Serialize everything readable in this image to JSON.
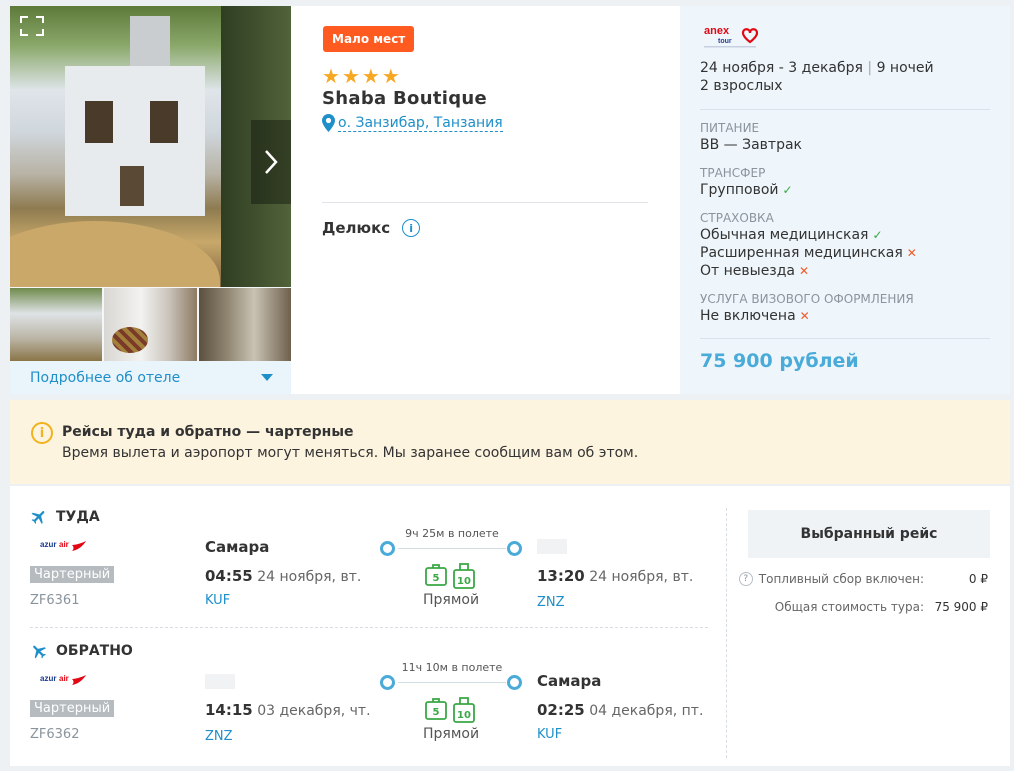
{
  "hotel": {
    "badge": "Мало мест",
    "stars": 4,
    "name": "Shaba Boutique",
    "location": "о. Занзибар, Танзания",
    "room": "Делюкс",
    "more_link": "Подробнее об отеле"
  },
  "tour": {
    "dates": "24 ноября - 3 декабря",
    "nights": "9 ночей",
    "guests": "2 взрослых",
    "meal_label": "ПИТАНИЕ",
    "meal_value": "BB — Завтрак",
    "transfer_label": "ТРАНСФЕР",
    "transfer_value": "Групповой",
    "insurance_label": "СТРАХОВКА",
    "insurance_items": [
      {
        "text": "Обычная медицинская",
        "included": true
      },
      {
        "text": "Расширенная медицинская",
        "included": false
      },
      {
        "text": "От невыезда",
        "included": false
      }
    ],
    "visa_label": "УСЛУГА ВИЗОВОГО ОФОРМЛЕНИЯ",
    "visa_value": "Не включена",
    "price": "75 900 рублей",
    "brand_color": "#4aabd9"
  },
  "warning": {
    "title": "Рейсы туда и обратно — чартерные",
    "text": "Время вылета и аэропорт могут меняться. Мы заранее сообщим вам об этом."
  },
  "flights": {
    "outbound": {
      "direction": "ТУДА",
      "charter": "Чартерный",
      "flight_number": "ZF6361",
      "dep_city": "Самара",
      "dep_time": "04:55",
      "dep_date": "24 ноября, вт.",
      "dep_code": "KUF",
      "duration": "9ч 25м в полете",
      "type": "Прямой",
      "arr_time": "13:20",
      "arr_date": "24 ноября, вт.",
      "arr_code": "ZNZ",
      "baggage": [
        "5",
        "10"
      ]
    },
    "inbound": {
      "direction": "ОБРАТНО",
      "charter": "Чартерный",
      "flight_number": "ZF6362",
      "dep_time": "14:15",
      "dep_date": "03 декабря, чт.",
      "dep_code": "ZNZ",
      "duration": "11ч 10м в полете",
      "type": "Прямой",
      "arr_city": "Самара",
      "arr_time": "02:25",
      "arr_date": "04 декабря, пт.",
      "arr_code": "KUF",
      "baggage": [
        "5",
        "10"
      ]
    }
  },
  "summary": {
    "selected": "Выбранный рейс",
    "fuel_label": "Топливный сбор включен:",
    "fuel_value": "0 ₽",
    "total_label": "Общая стоимость тура:",
    "total_value": "75 900 ₽"
  }
}
